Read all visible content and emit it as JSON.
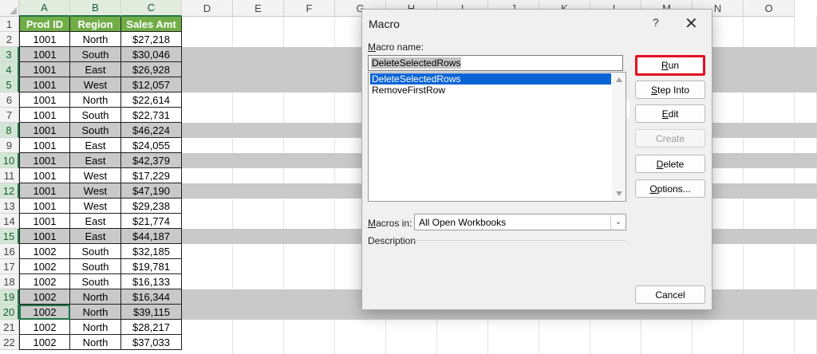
{
  "spreadsheet": {
    "column_headers": [
      "A",
      "B",
      "C",
      "D",
      "E",
      "F",
      "G",
      "H",
      "I",
      "J",
      "K",
      "L",
      "M",
      "N",
      "O"
    ],
    "header_row": {
      "row_number": "1",
      "cells": [
        "Prod ID",
        "Region",
        "Sales Amt"
      ]
    },
    "rows": [
      {
        "row_number": "2",
        "cells": [
          "1001",
          "North",
          "$27,218"
        ],
        "highlighted": false
      },
      {
        "row_number": "3",
        "cells": [
          "1001",
          "South",
          "$30,046"
        ],
        "highlighted": true
      },
      {
        "row_number": "4",
        "cells": [
          "1001",
          "East",
          "$26,928"
        ],
        "highlighted": true
      },
      {
        "row_number": "5",
        "cells": [
          "1001",
          "West",
          "$12,057"
        ],
        "highlighted": true
      },
      {
        "row_number": "6",
        "cells": [
          "1001",
          "North",
          "$22,614"
        ],
        "highlighted": false
      },
      {
        "row_number": "7",
        "cells": [
          "1001",
          "South",
          "$22,731"
        ],
        "highlighted": false
      },
      {
        "row_number": "8",
        "cells": [
          "1001",
          "South",
          "$46,224"
        ],
        "highlighted": true
      },
      {
        "row_number": "9",
        "cells": [
          "1001",
          "East",
          "$24,055"
        ],
        "highlighted": false
      },
      {
        "row_number": "10",
        "cells": [
          "1001",
          "East",
          "$42,379"
        ],
        "highlighted": true
      },
      {
        "row_number": "11",
        "cells": [
          "1001",
          "West",
          "$17,229"
        ],
        "highlighted": false
      },
      {
        "row_number": "12",
        "cells": [
          "1001",
          "West",
          "$47,190"
        ],
        "highlighted": true
      },
      {
        "row_number": "13",
        "cells": [
          "1001",
          "West",
          "$29,238"
        ],
        "highlighted": false
      },
      {
        "row_number": "14",
        "cells": [
          "1001",
          "East",
          "$21,774"
        ],
        "highlighted": false
      },
      {
        "row_number": "15",
        "cells": [
          "1001",
          "East",
          "$44,187"
        ],
        "highlighted": true
      },
      {
        "row_number": "16",
        "cells": [
          "1002",
          "South",
          "$32,185"
        ],
        "highlighted": false
      },
      {
        "row_number": "17",
        "cells": [
          "1002",
          "South",
          "$19,781"
        ],
        "highlighted": false
      },
      {
        "row_number": "18",
        "cells": [
          "1002",
          "South",
          "$16,133"
        ],
        "highlighted": false
      },
      {
        "row_number": "19",
        "cells": [
          "1002",
          "North",
          "$16,344"
        ],
        "highlighted": true
      },
      {
        "row_number": "20",
        "cells": [
          "1002",
          "North",
          "$39,115"
        ],
        "highlighted": true
      },
      {
        "row_number": "21",
        "cells": [
          "1002",
          "North",
          "$28,217"
        ],
        "highlighted": false
      },
      {
        "row_number": "22",
        "cells": [
          "1002",
          "North",
          "$37,033"
        ],
        "highlighted": false
      }
    ],
    "header_fill_color": "#70ad47",
    "highlight_color": "#c9c9c9"
  },
  "macro_dialog": {
    "title": "Macro",
    "help_label": "?",
    "close_label": "✕",
    "macro_name_label": "Macro name:",
    "macro_name_value": "DeleteSelectedRows",
    "upload_icon": "⭱",
    "macro_list": [
      "DeleteSelectedRows",
      "RemoveFirstRow"
    ],
    "selected_macro": "DeleteSelectedRows",
    "macros_in_label": "Macros in:",
    "macros_in_value": "All Open Workbooks",
    "description_label": "Description",
    "buttons": {
      "run": "Run",
      "step_into": "Step Into",
      "edit": "Edit",
      "create": "Create",
      "delete": "Delete",
      "options": "Options...",
      "cancel": "Cancel"
    },
    "run_highlight_color": "#e3101f"
  }
}
